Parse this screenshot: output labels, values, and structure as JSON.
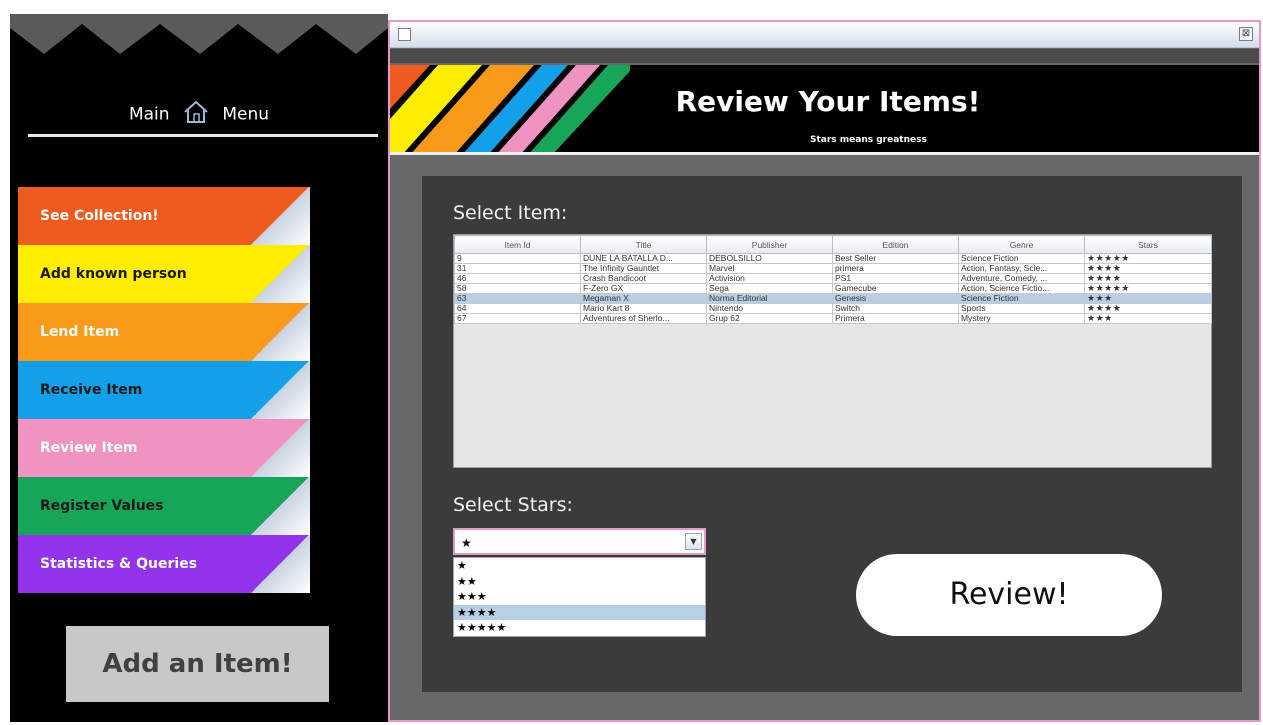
{
  "sidebar": {
    "menu_left": "Main",
    "menu_right": "Menu",
    "items": [
      {
        "label": "See Collection!",
        "bg": "#ef5a1e",
        "fg": "#ffffff"
      },
      {
        "label": "Add known person",
        "bg": "#ffed00",
        "fg": "#1a1a1a"
      },
      {
        "label": "Lend Item",
        "bg": "#fa9a1b",
        "fg": "#ffffff"
      },
      {
        "label": "Receive Item",
        "bg": "#14a0e8",
        "fg": "#1a1a1a"
      },
      {
        "label": "Review Item",
        "bg": "#f093c2",
        "fg": "#ffffff"
      },
      {
        "label": "Register Values",
        "bg": "#17a55a",
        "fg": "#1a1a1a"
      },
      {
        "label": "Statistics & Queries",
        "bg": "#9333ea",
        "fg": "#ffffff"
      }
    ],
    "add_item_label": "Add an Item!"
  },
  "window": {
    "close_glyph": "⊠"
  },
  "banner": {
    "title": "Review Your Items!",
    "subtitle": "Stars means greatness"
  },
  "select_item_label": "Select Item:",
  "table": {
    "columns": [
      "Item Id",
      "Title",
      "Publisher",
      "Edition",
      "Genre",
      "Stars"
    ],
    "rows": [
      [
        "9",
        "DUNE LA BATALLA D...",
        "DEBOLSILLO",
        "Best Seller",
        "Science Fiction",
        "★★★★★"
      ],
      [
        "31",
        "The Infinity Gauntlet",
        "Marvel",
        "primera",
        "Action, Fantasy, Scie...",
        "★★★★"
      ],
      [
        "46",
        "Crash Bandicoot",
        "Activision",
        "PS1",
        "Adventure, Comedy, ...",
        "★★★★"
      ],
      [
        "58",
        "F-Zero GX",
        "Sega",
        "Gamecube",
        "Action, Science Fictio...",
        "★★★★★"
      ],
      [
        "63",
        "Megaman X",
        "Norma Editorial",
        "Genesis",
        "Science Fiction",
        "★★★"
      ],
      [
        "64",
        "Mario Kart 8",
        "Nintendo",
        "Switch",
        "Sports",
        "★★★★"
      ],
      [
        "67",
        "Adventures of Sherlo...",
        "Grup 62",
        "Primera",
        "Mystery",
        "★★★"
      ]
    ],
    "selected_row": 4
  },
  "select_stars_label": "Select Stars:",
  "stars_combo": {
    "value": "★",
    "options": [
      "★",
      "★★",
      "★★★",
      "★★★★",
      "★★★★★"
    ],
    "highlighted_option": 3
  },
  "review_button_label": "Review!"
}
